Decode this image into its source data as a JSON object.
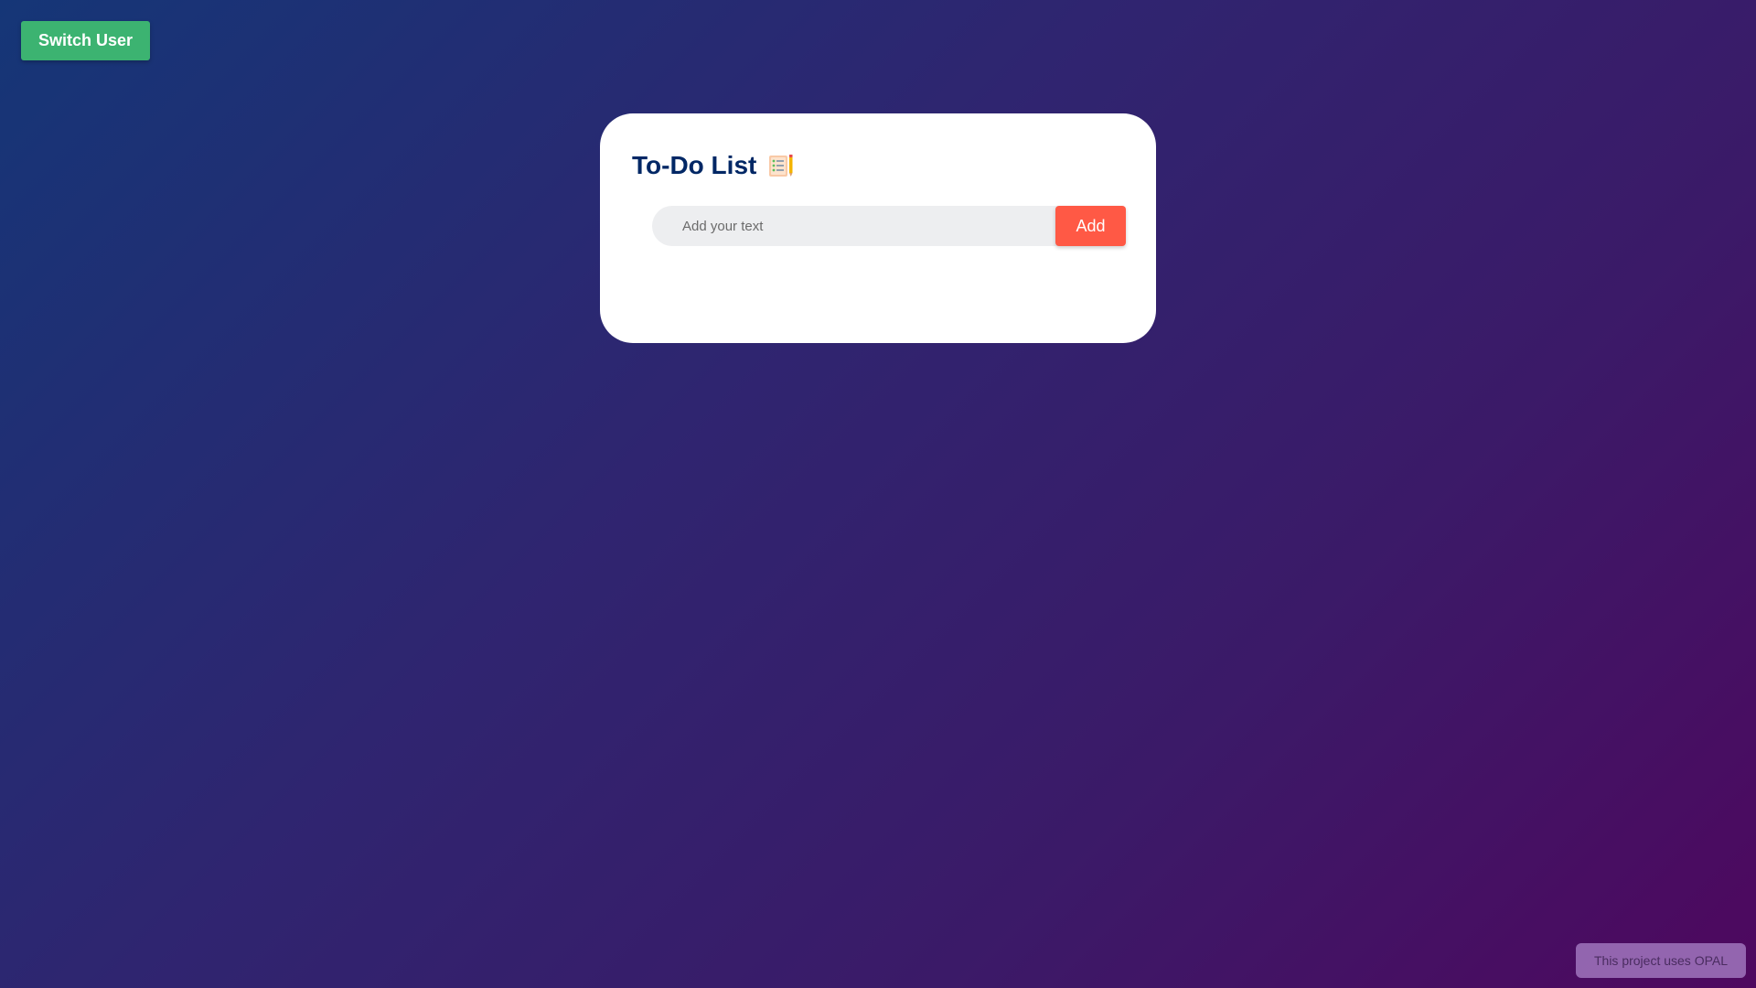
{
  "header": {
    "switch_user_label": "Switch User"
  },
  "todo": {
    "title": "To-Do List",
    "title_icon": "notepad-checklist-icon",
    "input": {
      "placeholder": "Add your text",
      "value": ""
    },
    "add_label": "Add",
    "items": []
  },
  "footer": {
    "badge_text": "This project uses OPAL"
  },
  "colors": {
    "switch_user_button": "#3cb371",
    "add_button": "#ff5945",
    "title_text": "#002765",
    "input_background": "#edeef0",
    "badge_background": "#9b6fb8",
    "background_gradient_start": "#153677",
    "background_gradient_end": "#4e085f"
  }
}
